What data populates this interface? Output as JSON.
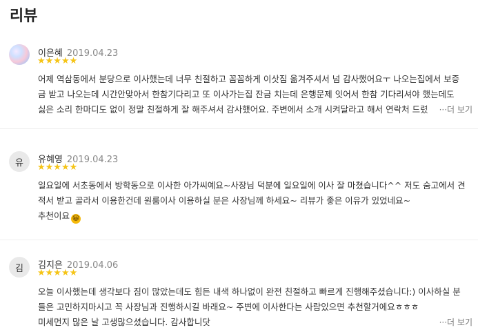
{
  "section_title": "리뷰",
  "more_label": "···더 보기",
  "reviews": [
    {
      "avatar_text": "",
      "name": "이은혜",
      "date": "2019.04.23",
      "stars": "★★★★★",
      "lines": [
        "어제 역삼동에서 분당으로 이사했는데 너무 친절하고 꼼꼼하게 이삿짐 옮겨주셔서 넘 감사했어요ㅜ 나오는집에서 보증",
        "금 받고 나오는데 시간안맞아서 한참기다리고 또 이사가는집 잔금 치는데 은행문제 잇어서 한참 기다리셔야 했는데도",
        "싫은 소리 한마디도 없이 정말 친절하게 잘 해주셔서 감사했어요. 주변에서 소개 시켜달라고 해서 연락처 드렸"
      ]
    },
    {
      "avatar_text": "유",
      "name": "유혜영",
      "date": "2019.04.23",
      "stars": "★★★★★",
      "lines": [
        "일요일에 서초동에서 방학동으로 이사한 아가씨예요~사장님 덕분에 일요일에 이사 잘 마쳤습니다^^ 저도 숨고에서 견",
        "적서 받고 골라서 이용한건데 원룸이사 이용하실 분은 사장님께 하세요~ 리뷰가 좋은 이유가 있었네요~",
        "추천이요"
      ],
      "emoji": "😀"
    },
    {
      "avatar_text": "김",
      "name": "김지은",
      "date": "2019.04.06",
      "stars": "★★★★★",
      "lines": [
        "오늘 이사했는데 생각보다 짐이 많았는데도 힘든 내색 하나없이 완전 친절하고 빠르게 진행해주셨습니다:) 이사하실 분",
        "들은 고민하지마시고 꼭 사장님과 진행하시길 바래요~ 주변에 이사한다는 사람있으면 추천할거에요ㅎㅎㅎ",
        "미세먼지 많은 날 고생많으셨습니다. 감사합니닷"
      ]
    }
  ]
}
